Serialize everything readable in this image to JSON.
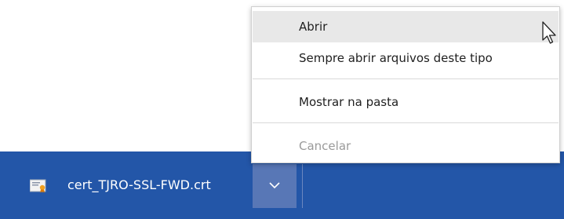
{
  "download": {
    "filename": "cert_TJRO-SSL-FWD.crt",
    "file_icon": "certificate-file-icon",
    "dropdown_icon": "chevron-down-icon"
  },
  "context_menu": {
    "items": [
      {
        "label": "Abrir",
        "state": "hovered"
      },
      {
        "label": "Sempre abrir arquivos deste tipo",
        "state": "normal"
      },
      {
        "label": "Mostrar na pasta",
        "state": "normal"
      },
      {
        "label": "Cancelar",
        "state": "disabled"
      }
    ]
  },
  "colors": {
    "download_bar": "#2356a8",
    "dropdown_button": "#5877b6",
    "menu_hover": "#e8e8e8",
    "disabled_text": "#9a9a9a"
  },
  "cursor_icon": "mouse-pointer-icon"
}
